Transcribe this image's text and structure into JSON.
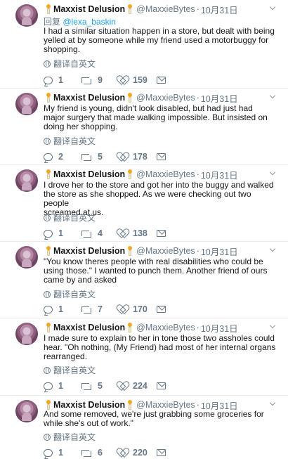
{
  "tweets": [
    {
      "name": "Maxxist Delusion",
      "handle": "@MaxxieBytes",
      "date": "10月31日",
      "reply_prefix": "回复",
      "reply_to": "@lexa_baskin",
      "lines": [
        "I had a similar situation happen in a store, but dealt with being",
        "yelled at by someone while my friend used a motorbuggy for",
        "shopping."
      ],
      "translate": "翻译自英文",
      "replies": "1",
      "retweets": "9",
      "likes": "159"
    },
    {
      "name": "Maxxist Delusion",
      "handle": "@MaxxieBytes",
      "date": "10月31日",
      "lines": [
        "My friend is young, didn't look disabled, but had just had",
        "major surgery that made walking impossible. But insisted on",
        "doing her shopping."
      ],
      "translate": "翻译自英文",
      "replies": "2",
      "retweets": "5",
      "likes": "178"
    },
    {
      "name": "Maxxist Delusion",
      "handle": "@MaxxieBytes",
      "date": "10月31日",
      "lines": [
        "I drove her to the store and got her into the buggy and walked",
        "the store as she shopped. As we were checking out two people",
        "screamed at us."
      ],
      "translate": "翻译自英文",
      "replies": "1",
      "retweets": "4",
      "likes": "138"
    },
    {
      "name": "Maxxist Delusion",
      "handle": "@MaxxieBytes",
      "date": "10月31日",
      "lines": [
        "\"You know theres people with real disabilities who could be",
        "using those.\" I wanted to punch them. Another friend of ours",
        "came by and asked"
      ],
      "translate": "翻译自英文",
      "replies": "1",
      "retweets": "7",
      "likes": "170"
    },
    {
      "name": "Maxxist Delusion",
      "handle": "@MaxxieBytes",
      "date": "10月31日",
      "lines": [
        "I made sure to explain to her in tone those two assholes could",
        "hear. \"Oh nothing, (My Friend) had most of her internal organs",
        "rearranged."
      ],
      "translate": "翻译自英文",
      "replies": "1",
      "retweets": "5",
      "likes": "224"
    },
    {
      "name": "Maxxist Delusion",
      "handle": "@MaxxieBytes",
      "date": "10月31日",
      "lines": [
        "And some removed, we're just grabbing some groceries for",
        "while she's out of work.\""
      ],
      "translate": "翻译自英文",
      "replies": "1",
      "retweets": "6",
      "likes": "220"
    }
  ]
}
